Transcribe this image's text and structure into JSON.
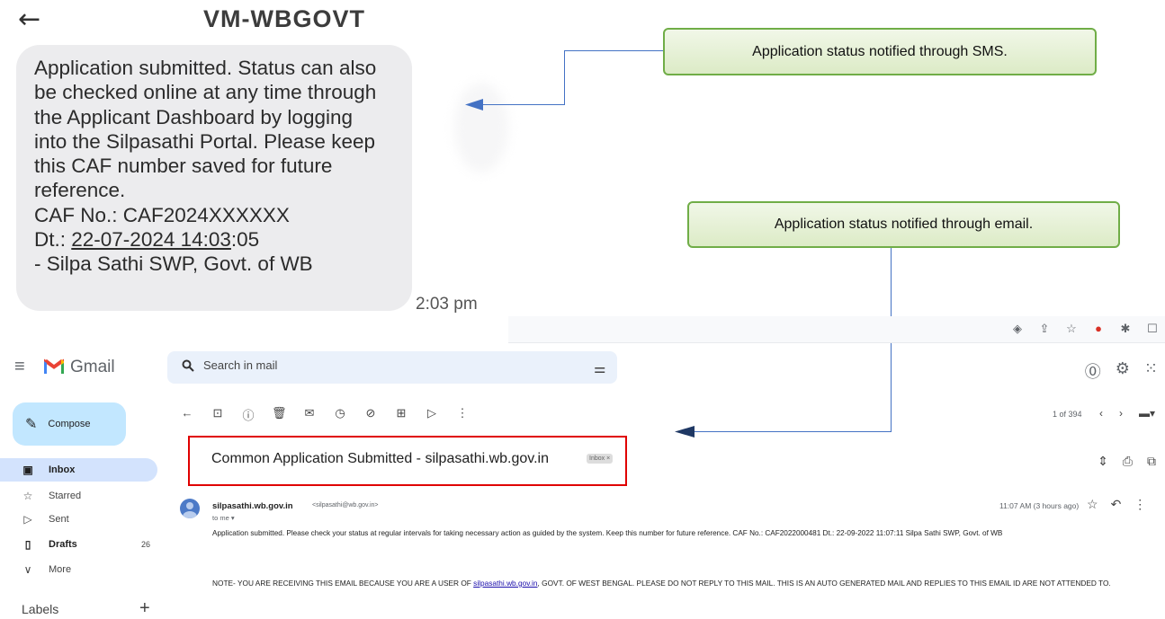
{
  "sms": {
    "sender": "VM-WBGOVT",
    "lines": [
      "Application submitted. Status can also",
      "be checked online at any time through",
      "the Applicant Dashboard by logging",
      "into the Silpasathi Portal. Please keep",
      "this CAF number saved for future",
      "reference.",
      "CAF No.: CAF2024XXXXXX"
    ],
    "date_prefix": "Dt.: ",
    "date_underlined": "22-07-2024 14:03",
    "date_suffix": ":05",
    "signature": "- Silpa Sathi SWP, Govt. of WB",
    "time": "2:03 pm"
  },
  "callouts": {
    "sms": "Application status notified through SMS.",
    "email": "Application status notified through email."
  },
  "gmail": {
    "app_name": "Gmail",
    "search_placeholder": "Search in mail",
    "compose_label": "Compose",
    "nav": [
      {
        "label": "Inbox",
        "icon": "inbox-icon"
      },
      {
        "label": "Starred",
        "icon": "star-icon"
      },
      {
        "label": "Sent",
        "icon": "send-icon"
      },
      {
        "label": "Drafts",
        "icon": "draft-icon",
        "count": "26"
      },
      {
        "label": "More",
        "icon": "chevron-down-icon"
      }
    ],
    "labels_heading": "Labels",
    "pager": "1 of 394",
    "subject": "Common Application Submitted - silpasathi.wb.gov.in",
    "subject_badge": "Inbox ×",
    "sender_name": "silpasathi.wb.gov.in",
    "sender_email": "<silpasathi@wb.gov.in>",
    "to": "to me ▾",
    "time": "11:07 AM (3 hours ago)",
    "body": "Application submitted. Please check your status at regular intervals for taking necessary action as guided by the system. Keep this number for future reference. CAF No.: CAF2022000481 Dt.: 22-09-2022 11:07:11 Silpa Sathi SWP, Govt. of WB",
    "note_before": "NOTE- YOU ARE RECEIVING THIS EMAIL BECAUSE YOU ARE A USER OF ",
    "note_link": "silpasathi.wb.gov.in",
    "note_after": ", GOVT. OF WEST BENGAL. PLEASE DO NOT REPLY TO THIS MAIL. THIS IS AN AUTO GENERATED MAIL AND REPLIES TO THIS EMAIL ID ARE NOT ATTENDED TO."
  }
}
